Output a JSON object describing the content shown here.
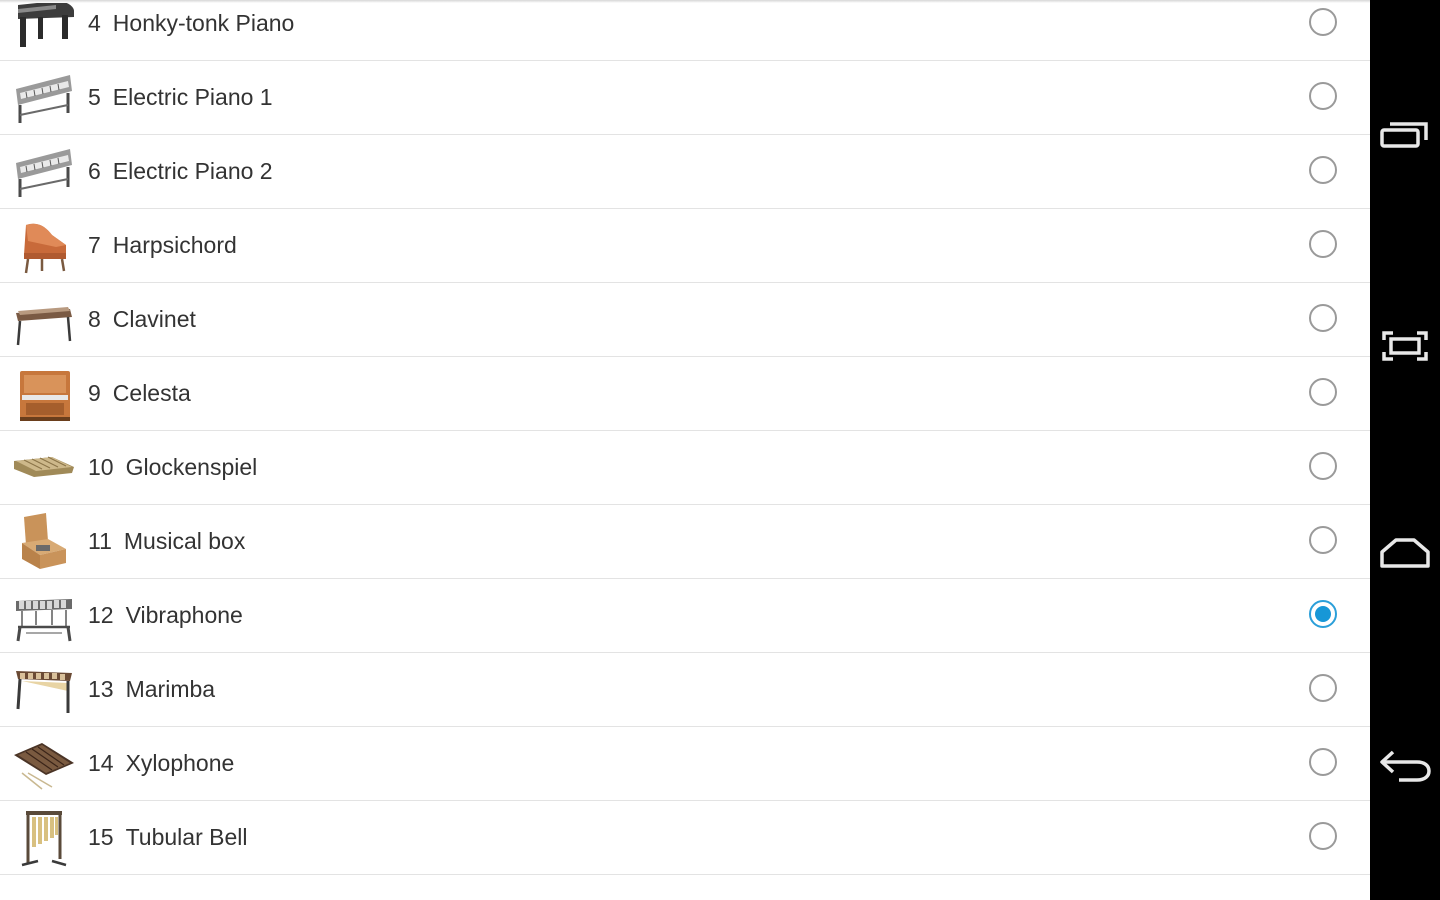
{
  "instruments": [
    {
      "num": "4",
      "name": "Honky-tonk Piano",
      "icon": "grand-piano-icon",
      "selected": false
    },
    {
      "num": "5",
      "name": "Electric Piano 1",
      "icon": "electric-piano-icon",
      "selected": false
    },
    {
      "num": "6",
      "name": "Electric Piano 2",
      "icon": "electric-piano-icon",
      "selected": false
    },
    {
      "num": "7",
      "name": "Harpsichord",
      "icon": "harpsichord-icon",
      "selected": false
    },
    {
      "num": "8",
      "name": "Clavinet",
      "icon": "clavinet-icon",
      "selected": false
    },
    {
      "num": "9",
      "name": "Celesta",
      "icon": "celesta-icon",
      "selected": false
    },
    {
      "num": "10",
      "name": "Glockenspiel",
      "icon": "glockenspiel-icon",
      "selected": false
    },
    {
      "num": "11",
      "name": "Musical box",
      "icon": "music-box-icon",
      "selected": false
    },
    {
      "num": "12",
      "name": "Vibraphone",
      "icon": "vibraphone-icon",
      "selected": true
    },
    {
      "num": "13",
      "name": "Marimba",
      "icon": "marimba-icon",
      "selected": false
    },
    {
      "num": "14",
      "name": "Xylophone",
      "icon": "xylophone-icon",
      "selected": false
    },
    {
      "num": "15",
      "name": "Tubular Bell",
      "icon": "tubular-bell-icon",
      "selected": false
    }
  ],
  "navigation_bar": {
    "buttons": [
      "recent-apps-icon",
      "screenshot-icon",
      "home-icon",
      "back-icon"
    ]
  },
  "colors": {
    "accent": "#1797d7",
    "text": "#333333",
    "divider": "#e3e3e3",
    "nav_background": "#000000"
  }
}
